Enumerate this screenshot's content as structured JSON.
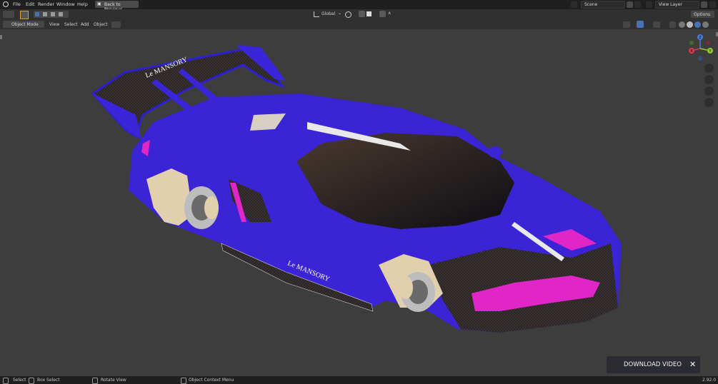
{
  "menu": {
    "items": [
      "File",
      "Edit",
      "Render",
      "Window",
      "Help"
    ],
    "back_button": "Back to Previous"
  },
  "scene": {
    "label": "Scene"
  },
  "view_layer": {
    "label": "View Layer"
  },
  "tool_header": {
    "transform_orientation": "Global",
    "options_label": "Options"
  },
  "view_header": {
    "mode": "Object Mode",
    "view": "View",
    "select": "Select",
    "add": "Add",
    "object": "Object"
  },
  "car": {
    "wing_text": "Le MANSORY",
    "side_text": "Le MANSORY"
  },
  "gizmo": {
    "x": "X",
    "y": "Y",
    "z": "Z"
  },
  "download": {
    "label": "DOWNLOAD VIDEO",
    "close": "✕"
  },
  "status": {
    "select": "Select",
    "box_select": "Box Select",
    "rotate_view": "Rotate View",
    "context_menu": "Object Context Menu",
    "version": "2.92.0"
  },
  "colors": {
    "body_blue": "#3a24d6",
    "accent_magenta": "#e126c8",
    "viewport_bg": "#3d3d3d"
  }
}
